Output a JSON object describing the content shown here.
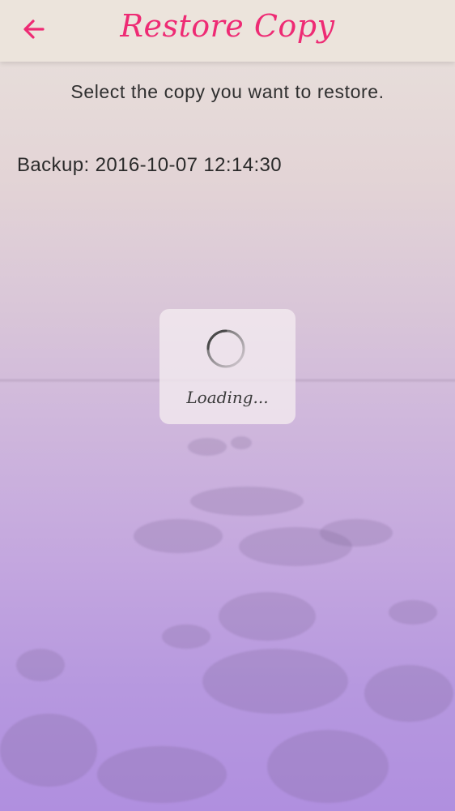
{
  "header": {
    "title": "Restore Copy",
    "back_icon": "arrow-left-icon",
    "accent_color": "#ee2b74"
  },
  "main": {
    "instruction": "Select the copy you want to restore.",
    "backups": [
      {
        "label": "Backup: 2016-10-07 12:14:30"
      }
    ]
  },
  "overlay": {
    "loading_text": "Loading...",
    "spinner_icon": "spinner-icon"
  }
}
